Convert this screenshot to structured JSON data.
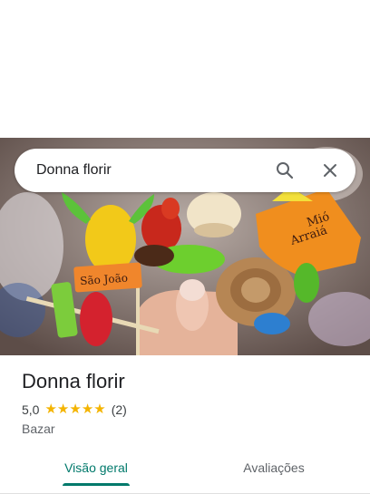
{
  "search": {
    "query": "Donna florir"
  },
  "place": {
    "name": "Donna florir",
    "rating": "5,0",
    "review_count": "(2)",
    "stars": 5,
    "category": "Bazar"
  },
  "photo": {
    "sign_left": "São João",
    "sign_right_line1": "Mió",
    "sign_right_line2": "Arraiá"
  },
  "tabs": [
    {
      "label": "Visão geral",
      "selected": true
    },
    {
      "label": "Avaliações",
      "selected": false
    }
  ],
  "colors": {
    "accent": "#00796b",
    "star": "#f4b400"
  }
}
